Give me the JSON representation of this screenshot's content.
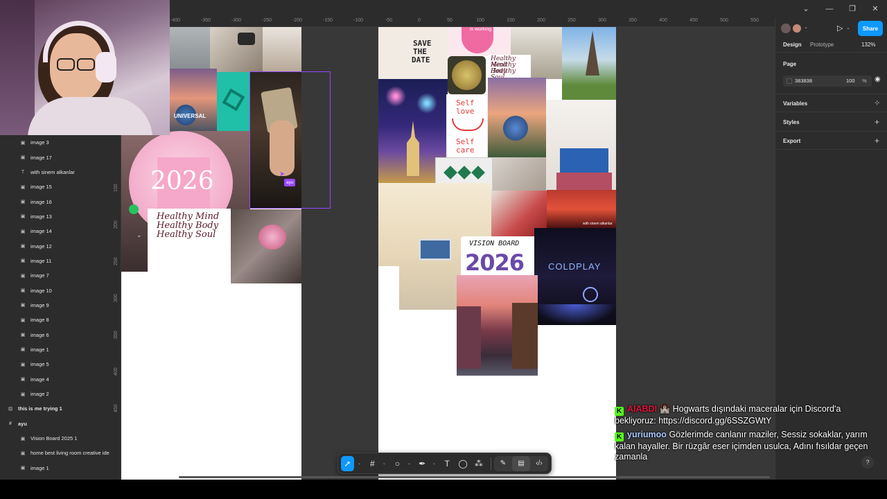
{
  "title_bar": {
    "controls": [
      "chevron-down",
      "minimize",
      "restore",
      "close"
    ]
  },
  "ruler_top": [
    "-400",
    "-350",
    "-300",
    "-250",
    "-200",
    "-150",
    "-100",
    "-50",
    "0",
    "50",
    "100",
    "150",
    "200",
    "250",
    "300",
    "350",
    "400",
    "450",
    "500",
    "550"
  ],
  "ruler_left": [
    "150",
    "200",
    "250",
    "300",
    "350",
    "400",
    "450"
  ],
  "layers": [
    {
      "label": "image 3",
      "type": "image"
    },
    {
      "label": "image 17",
      "type": "image"
    },
    {
      "label": "with sinem alkanlar",
      "type": "text"
    },
    {
      "label": "image 15",
      "type": "image"
    },
    {
      "label": "image 16",
      "type": "image"
    },
    {
      "label": "image 13",
      "type": "image"
    },
    {
      "label": "image 14",
      "type": "image"
    },
    {
      "label": "image 12",
      "type": "image"
    },
    {
      "label": "image 11",
      "type": "image"
    },
    {
      "label": "image 7",
      "type": "image"
    },
    {
      "label": "image 10",
      "type": "image"
    },
    {
      "label": "image 9",
      "type": "image"
    },
    {
      "label": "image 8",
      "type": "image"
    },
    {
      "label": "image 6",
      "type": "image"
    },
    {
      "label": "image 1",
      "type": "image"
    },
    {
      "label": "image 5",
      "type": "image"
    },
    {
      "label": "image 4",
      "type": "image"
    },
    {
      "label": "image 2",
      "type": "image"
    }
  ],
  "top_layers": [
    {
      "label": "this is me trying 1",
      "type": "component"
    },
    {
      "label": "ayu",
      "type": "frame"
    }
  ],
  "ayu_children": [
    {
      "label": "Vision Board 2025 1",
      "type": "image"
    },
    {
      "label": "home best living room creative ide",
      "type": "image"
    },
    {
      "label": "image 1",
      "type": "image"
    }
  ],
  "right_panel": {
    "tabs": [
      "Design",
      "Prototype"
    ],
    "zoom": "132%",
    "share_label": "Share",
    "page_section": "Page",
    "page_color": "383838",
    "page_opacity": "100",
    "opacity_unit": "%",
    "sections": [
      "Variables",
      "Styles",
      "Export"
    ]
  },
  "canvas": {
    "cursor_tag": "ayu",
    "bubble_year": "2026",
    "healthy_lines": [
      "Healthy Mind",
      "Healthy Body",
      "Healthy Soul"
    ],
    "save_the_date": [
      "SAVE",
      "THE",
      "DATE"
    ],
    "self_love": [
      "Self",
      "love",
      "Self",
      "care"
    ],
    "vision_board": "VISION BOARD",
    "vision_year": "2026",
    "coldplay": "COLDPLAY",
    "with_sinem": "with sinem alkanlar",
    "universal": "UNIVERSAL",
    "is_working": "is working"
  },
  "chat": [
    {
      "user": "AIABDI",
      "user_color": "#e0143c",
      "text": "🏰 Hogwarts dışındaki maceralar için Discord'a bekliyoruz: https://discord.gg/6SSZGWtY"
    },
    {
      "user": "yuriumoo",
      "user_color": "#a8c8ff",
      "text": "Gözlerimde canlanır maziler, Sessiz sokaklar, yarım kalan hayaller. Bir rüzgâr eser içimden usulca, Adını fısıldar geçen zamanla"
    }
  ],
  "toolbar": [
    "move-tool",
    "frame-tool",
    "shape-tool",
    "pen-tool",
    "text-tool",
    "comment-tool",
    "actions-tool"
  ],
  "help_label": "?",
  "colors": {
    "accent": "#0d99ff",
    "selection": "#9747ff",
    "kick": "#53fc18"
  }
}
